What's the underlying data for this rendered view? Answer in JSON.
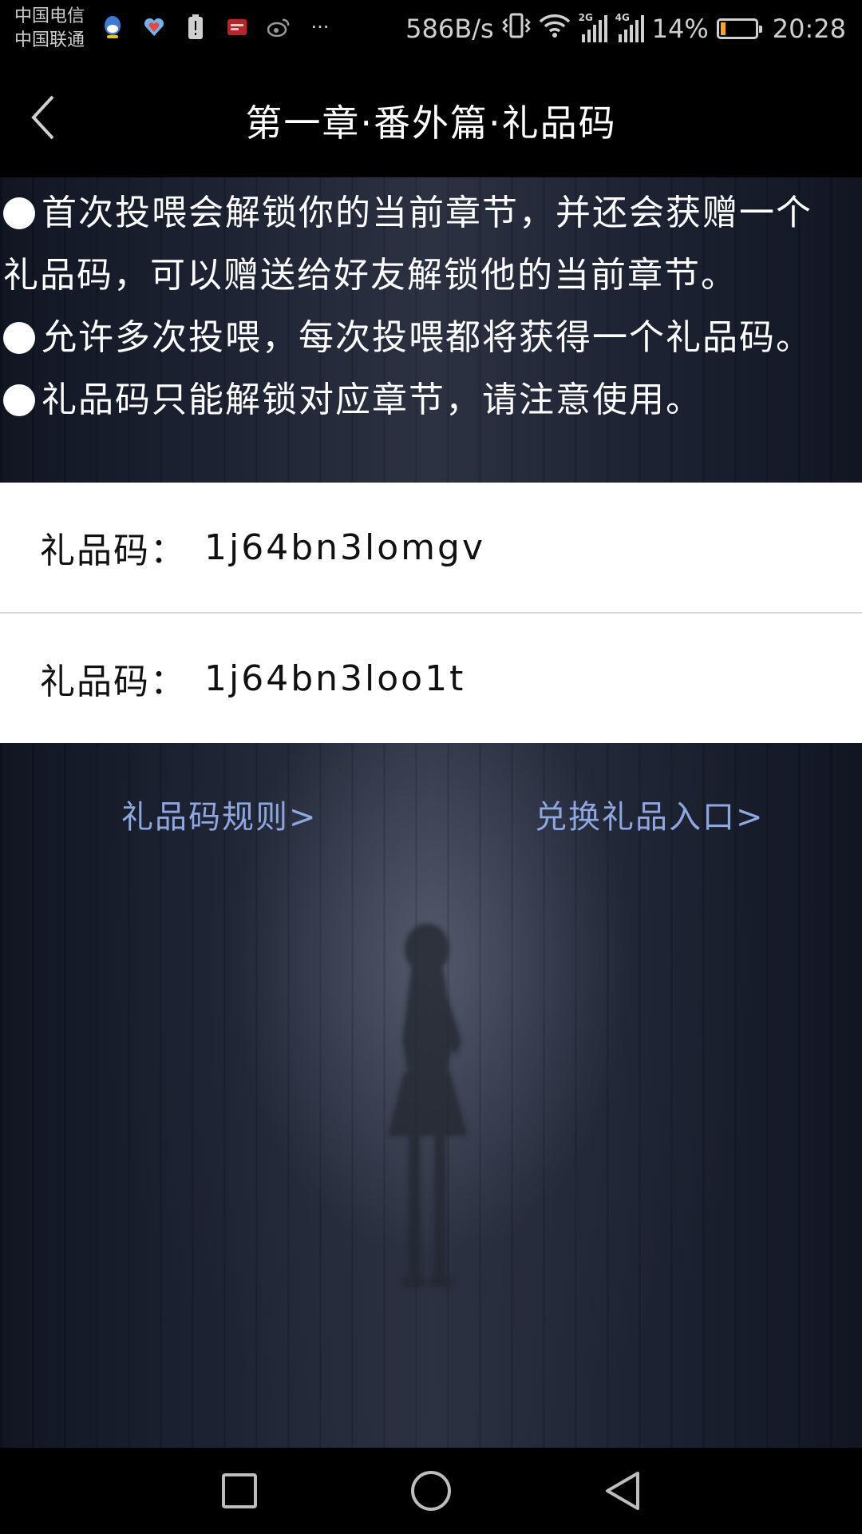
{
  "status_bar": {
    "carrier_1": "中国电信",
    "carrier_2": "中国联通",
    "more": "···",
    "net_speed": "586B/s",
    "net_2g": "2G",
    "net_4g": "4G",
    "battery_percent": "14%",
    "battery_level": 0.14,
    "time": "20:28",
    "battery_color": "#f5a623",
    "icons": [
      "qq-icon",
      "heart-shield-icon",
      "battery-alert-icon",
      "app-icon",
      "weibo-icon",
      "vibrate-icon",
      "wifi-icon",
      "signal-icon"
    ]
  },
  "header": {
    "title": "第一章·番外篇·礼品码"
  },
  "info": {
    "line_1": "首次投喂会解锁你的当前章节，并还会获赠一个",
    "line_2": "礼品码，可以赠送给好友解锁他的当前章节。",
    "line_3": "允许多次投喂，每次投喂都将获得一个礼品码。",
    "line_4": "礼品码只能解锁对应章节，请注意使用。"
  },
  "codes": [
    {
      "label": "礼品码：",
      "value": "1j64bn3lomgv"
    },
    {
      "label": "礼品码：",
      "value": "1j64bn3loo1t"
    }
  ],
  "links": {
    "rules": "礼品码规则>",
    "redeem": "兑换礼品入口>",
    "color": "#8ea7e0"
  }
}
